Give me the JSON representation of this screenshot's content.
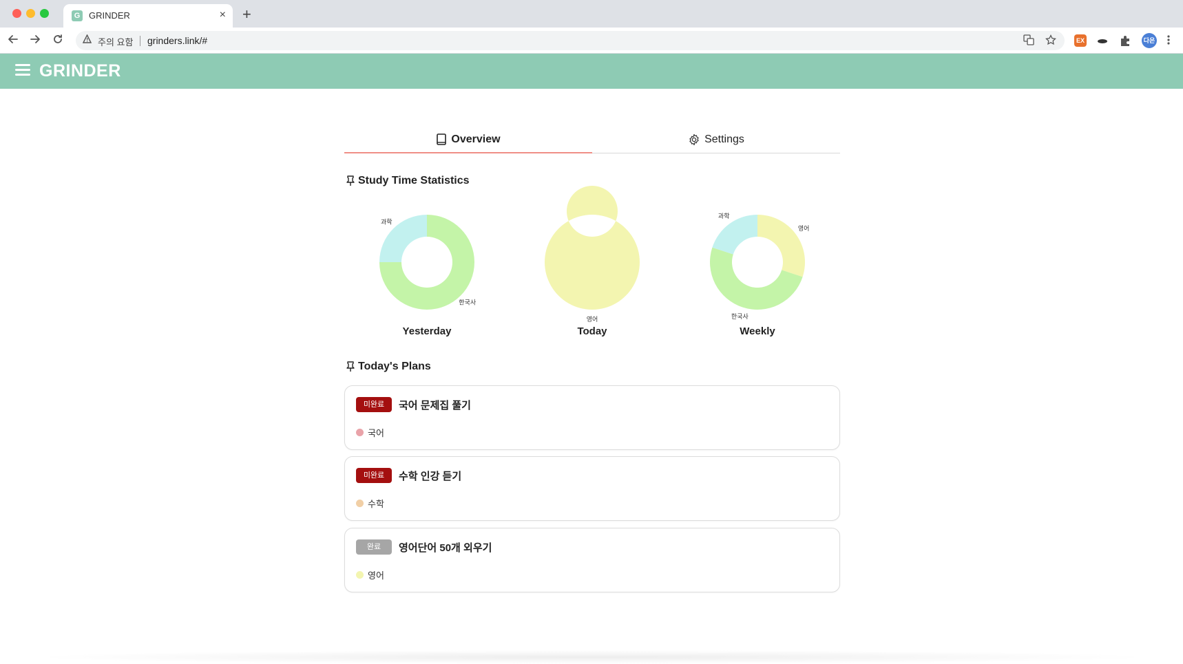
{
  "browser": {
    "tab_title": "GRINDER",
    "favicon_letter": "G",
    "close_glyph": "×",
    "new_tab_glyph": "+",
    "security_label": "주의 요함",
    "url": "grinders.link/#",
    "profile_initials": "다은",
    "ext_badge": "EX"
  },
  "app": {
    "brand": "GRINDER"
  },
  "tabs": [
    {
      "label": "Overview",
      "icon": "book-icon",
      "active": true
    },
    {
      "label": "Settings",
      "icon": "gear-icon",
      "active": false
    }
  ],
  "sections": {
    "stats_title": "Study Time Statistics",
    "plans_title": "Today's Plans"
  },
  "colors": {
    "header": "#8ecbb4",
    "tab_underline": "#ef8e86",
    "incomplete_badge": "#a40f0f",
    "complete_badge": "#a6a6a6",
    "subject_korean_history": "#c4f4a8",
    "subject_science": "#c2f1ef",
    "subject_english": "#f3f5b0"
  },
  "chart_data": [
    {
      "type": "pie",
      "title": "Yesterday",
      "categories": [
        "한국사",
        "과학"
      ],
      "values": [
        75,
        25
      ],
      "colors": [
        "#c4f4a8",
        "#c2f1ef"
      ]
    },
    {
      "type": "pie",
      "title": "Today",
      "categories": [
        "영어"
      ],
      "values": [
        100
      ],
      "colors": [
        "#f3f5b0"
      ]
    },
    {
      "type": "pie",
      "title": "Weekly",
      "categories": [
        "영어",
        "한국사",
        "과학"
      ],
      "values": [
        30,
        50,
        20
      ],
      "colors": [
        "#f3f5b0",
        "#c4f4a8",
        "#c2f1ef"
      ]
    }
  ],
  "plans": [
    {
      "status": "미완료",
      "title": "국어 문제집 풀기",
      "subject": "국어",
      "dot_color": "#e9a3a9",
      "badge_color": "#a40f0f"
    },
    {
      "status": "미완료",
      "title": "수학 인강 듣기",
      "subject": "수학",
      "dot_color": "#f1cfa6",
      "badge_color": "#a40f0f"
    },
    {
      "status": "완료",
      "title": "영어단어 50개 외우기",
      "subject": "영어",
      "dot_color": "#f3f5b0",
      "badge_color": "#a6a6a6"
    }
  ]
}
